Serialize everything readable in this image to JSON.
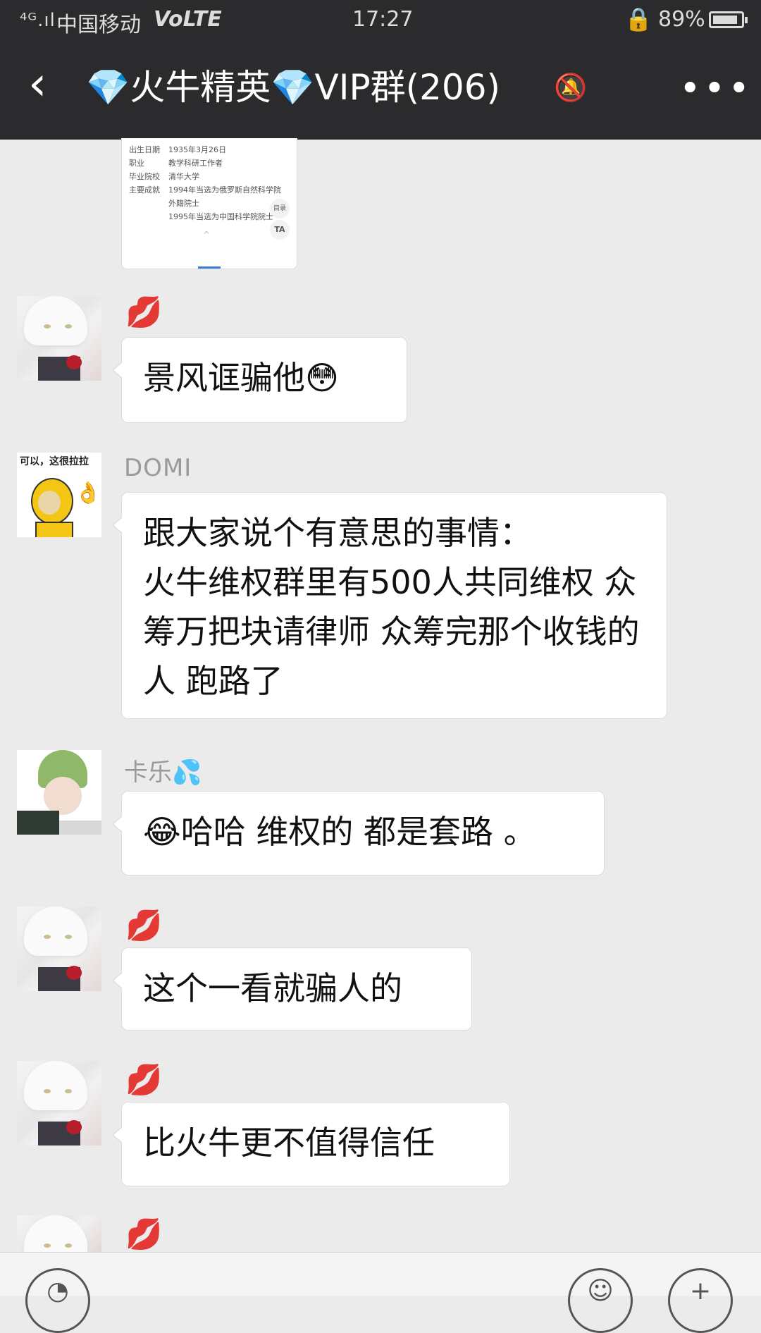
{
  "status_bar": {
    "signal": "⁴ᴳ.ıl",
    "carrier": "中国移动",
    "volte": "VoLTE",
    "time": "17:27",
    "lock_icon": "🔒",
    "battery": "89%",
    "battery_level": 0.89
  },
  "header": {
    "back_icon": "‹",
    "title": "💎火牛精英💎VIP群(206)",
    "mute_icon": "🔕",
    "more_icon": "•••"
  },
  "card": {
    "rows": [
      {
        "key": "出生日期",
        "value": "1935年3月26日"
      },
      {
        "key": "职业",
        "value": "教学科研工作者"
      },
      {
        "key": "毕业院校",
        "value": "清华大学"
      },
      {
        "key": "主要成就",
        "value": "1994年当选为俄罗斯自然科学院"
      },
      {
        "key": "",
        "value": "外籍院士"
      },
      {
        "key": "",
        "value": "1995年当选为中国科学院院士"
      }
    ],
    "toc": "目录",
    "ta": "TA",
    "chevron": "^"
  },
  "messages": [
    {
      "avatar": "white-hair-anime-avatar",
      "sender": "💋",
      "text": "景风诓骗他😳"
    },
    {
      "avatar": "domi-avatar",
      "avatar_caption": "可以，这很拉拉",
      "sender": "DOMI",
      "text": "跟大家说个有意思的事情：\n火牛维权群里有500人共同维权 众筹万把块请律师 众筹完那个收钱的人 跑路了"
    },
    {
      "avatar": "kale-avatar",
      "sender": "卡乐💦",
      "text": "😂哈哈 维权的 都是套路 。"
    },
    {
      "avatar": "white-hair-anime-avatar",
      "sender": "💋",
      "text": "这个一看就骗人的"
    },
    {
      "avatar": "white-hair-anime-avatar",
      "sender": "💋",
      "text": "比火牛更不值得信任"
    },
    {
      "avatar": "white-hair-anime-avatar",
      "sender": "💋",
      "text": ""
    }
  ],
  "input_bar": {
    "voice_icon": "◔",
    "emoji_icon": "☺",
    "plus_icon": "+"
  },
  "colors": {
    "header_bg": "#2b2b2d",
    "chat_bg": "#ebebeb",
    "bubble_bg": "#ffffff"
  }
}
